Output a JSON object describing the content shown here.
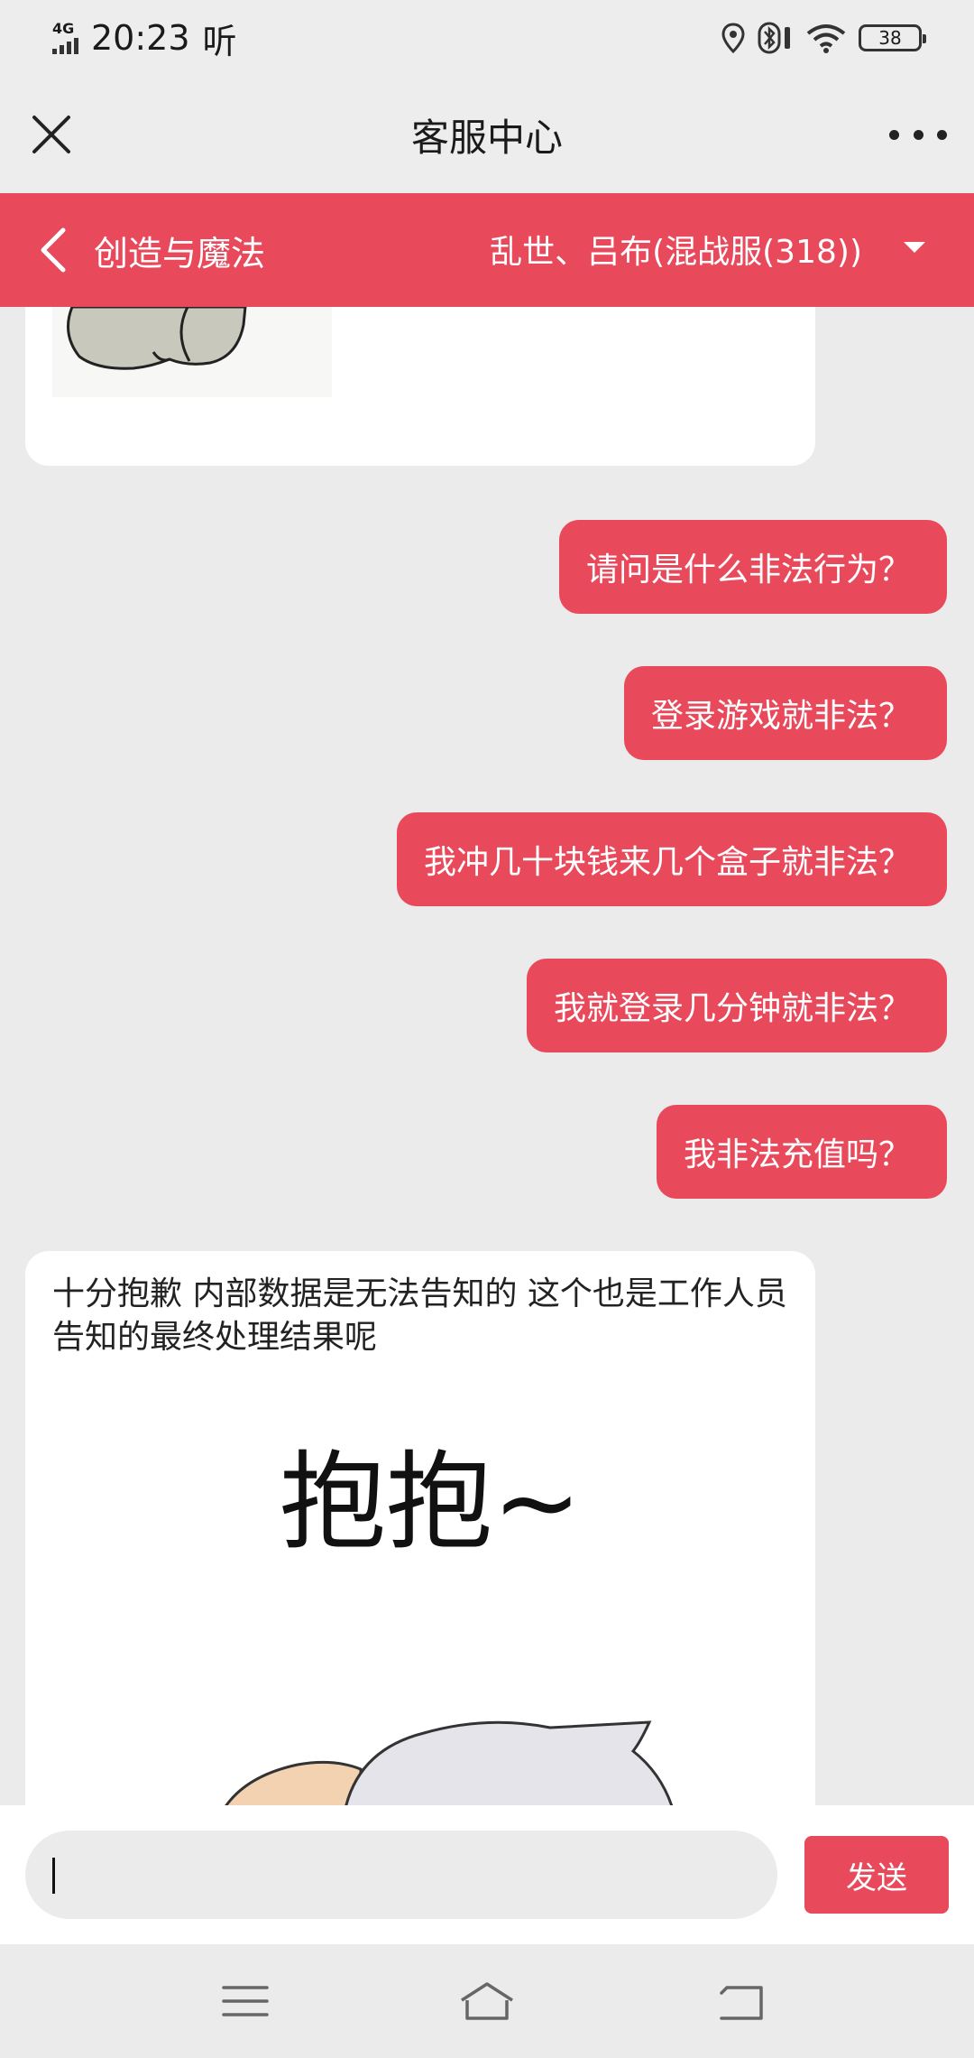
{
  "status_bar": {
    "network": "4G",
    "time": "20:23",
    "extra": "听",
    "battery": "38"
  },
  "title_bar": {
    "title": "客服中心",
    "close_icon": "close-icon",
    "more_icon": "more-icon"
  },
  "header": {
    "back_label": "创造与魔法",
    "server_label": "乱世、吕布(混战服(318))",
    "colors": {
      "accent": "#e84a5c"
    }
  },
  "messages": [
    {
      "from": "user",
      "text": "请问是什么非法行为？"
    },
    {
      "from": "user",
      "text": "登录游戏就非法？"
    },
    {
      "from": "user",
      "text": "我冲几十块钱来几个盒子就非法？"
    },
    {
      "from": "user",
      "text": "我就登录几分钟就非法？"
    },
    {
      "from": "user",
      "text": "我非法充值吗？"
    },
    {
      "from": "agent",
      "text": "十分抱歉 内部数据是无法告知的  这个也是工作人员告知的最终处理结果呢"
    }
  ],
  "sticker": {
    "caption": "抱抱~"
  },
  "input": {
    "value": "",
    "send_label": "发送"
  },
  "nav": {
    "menu_icon": "menu-icon",
    "home_icon": "home-icon",
    "back_icon": "back-icon"
  }
}
